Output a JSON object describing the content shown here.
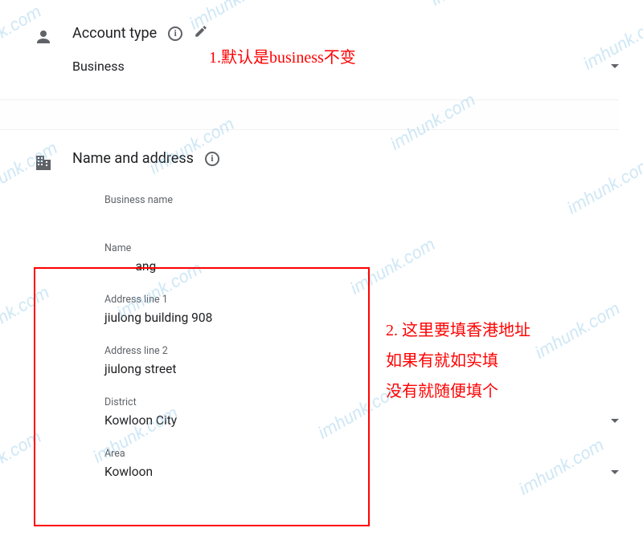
{
  "watermark_text": "imhunk.com",
  "section_account": {
    "title": "Account type",
    "selected": "Business"
  },
  "section_address": {
    "title": "Name and address",
    "business_name": {
      "label": "Business name",
      "value": ""
    },
    "name": {
      "label": "Name",
      "value": "          ang"
    },
    "address1": {
      "label": "Address line 1",
      "value": "jiulong building 908"
    },
    "address2": {
      "label": "Address line 2",
      "value": "jiulong street"
    },
    "district": {
      "label": "District",
      "value": "Kowloon City"
    },
    "area": {
      "label": "Area",
      "value": "Kowloon"
    }
  },
  "annotations": {
    "a1": "1.默认是business不变",
    "a2_l1": "2. 这里要填香港地址",
    "a2_l2": "如果有就如实填",
    "a2_l3": "没有就随便填个"
  }
}
